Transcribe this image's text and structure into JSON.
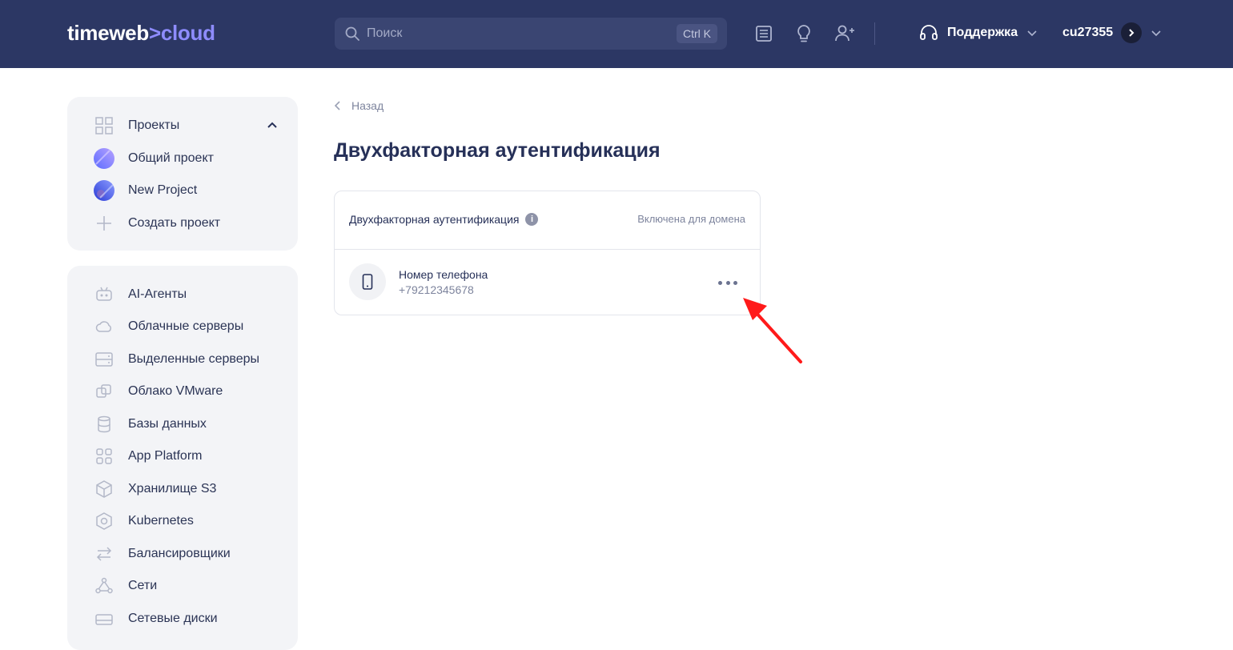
{
  "header": {
    "logo_main": "timeweb",
    "logo_sep": ">",
    "logo_accent": "cloud",
    "search_placeholder": "Поиск",
    "search_shortcut": "Ctrl K",
    "icons": [
      "news-icon",
      "lightbulb-icon",
      "add-user-icon"
    ],
    "support_label": "Поддержка",
    "username": "cu27355"
  },
  "projects": {
    "title": "Проекты",
    "items": [
      {
        "label": "Общий проект"
      },
      {
        "label": "New Project"
      }
    ],
    "create_label": "Создать проект"
  },
  "nav": {
    "items": [
      {
        "label": "AI-Агенты",
        "icon": "robot-icon"
      },
      {
        "label": "Облачные серверы",
        "icon": "cloud-icon"
      },
      {
        "label": "Выделенные серверы",
        "icon": "server-icon"
      },
      {
        "label": "Облако VMware",
        "icon": "vmware-icon"
      },
      {
        "label": "Базы данных",
        "icon": "database-icon"
      },
      {
        "label": "App Platform",
        "icon": "apps-grid-icon"
      },
      {
        "label": "Хранилище S3",
        "icon": "cube-icon"
      },
      {
        "label": "Kubernetes",
        "icon": "kubernetes-icon"
      },
      {
        "label": "Балансировщики",
        "icon": "arrows-swap-icon"
      },
      {
        "label": "Сети",
        "icon": "network-icon"
      },
      {
        "label": "Сетевые диски",
        "icon": "disk-icon"
      }
    ]
  },
  "page": {
    "back_label": "Назад",
    "title": "Двухфакторная аутентификация"
  },
  "panel": {
    "header_title": "Двухфакторная аутентификация",
    "status": "Включена для домена",
    "method_label": "Номер телефона",
    "method_value": "+79212345678"
  },
  "colors": {
    "header_bg": "#2c3764",
    "accent": "#8e8cff",
    "sidebar_bg": "#f3f4f7",
    "annotation_arrow": "#ff1a1a"
  }
}
